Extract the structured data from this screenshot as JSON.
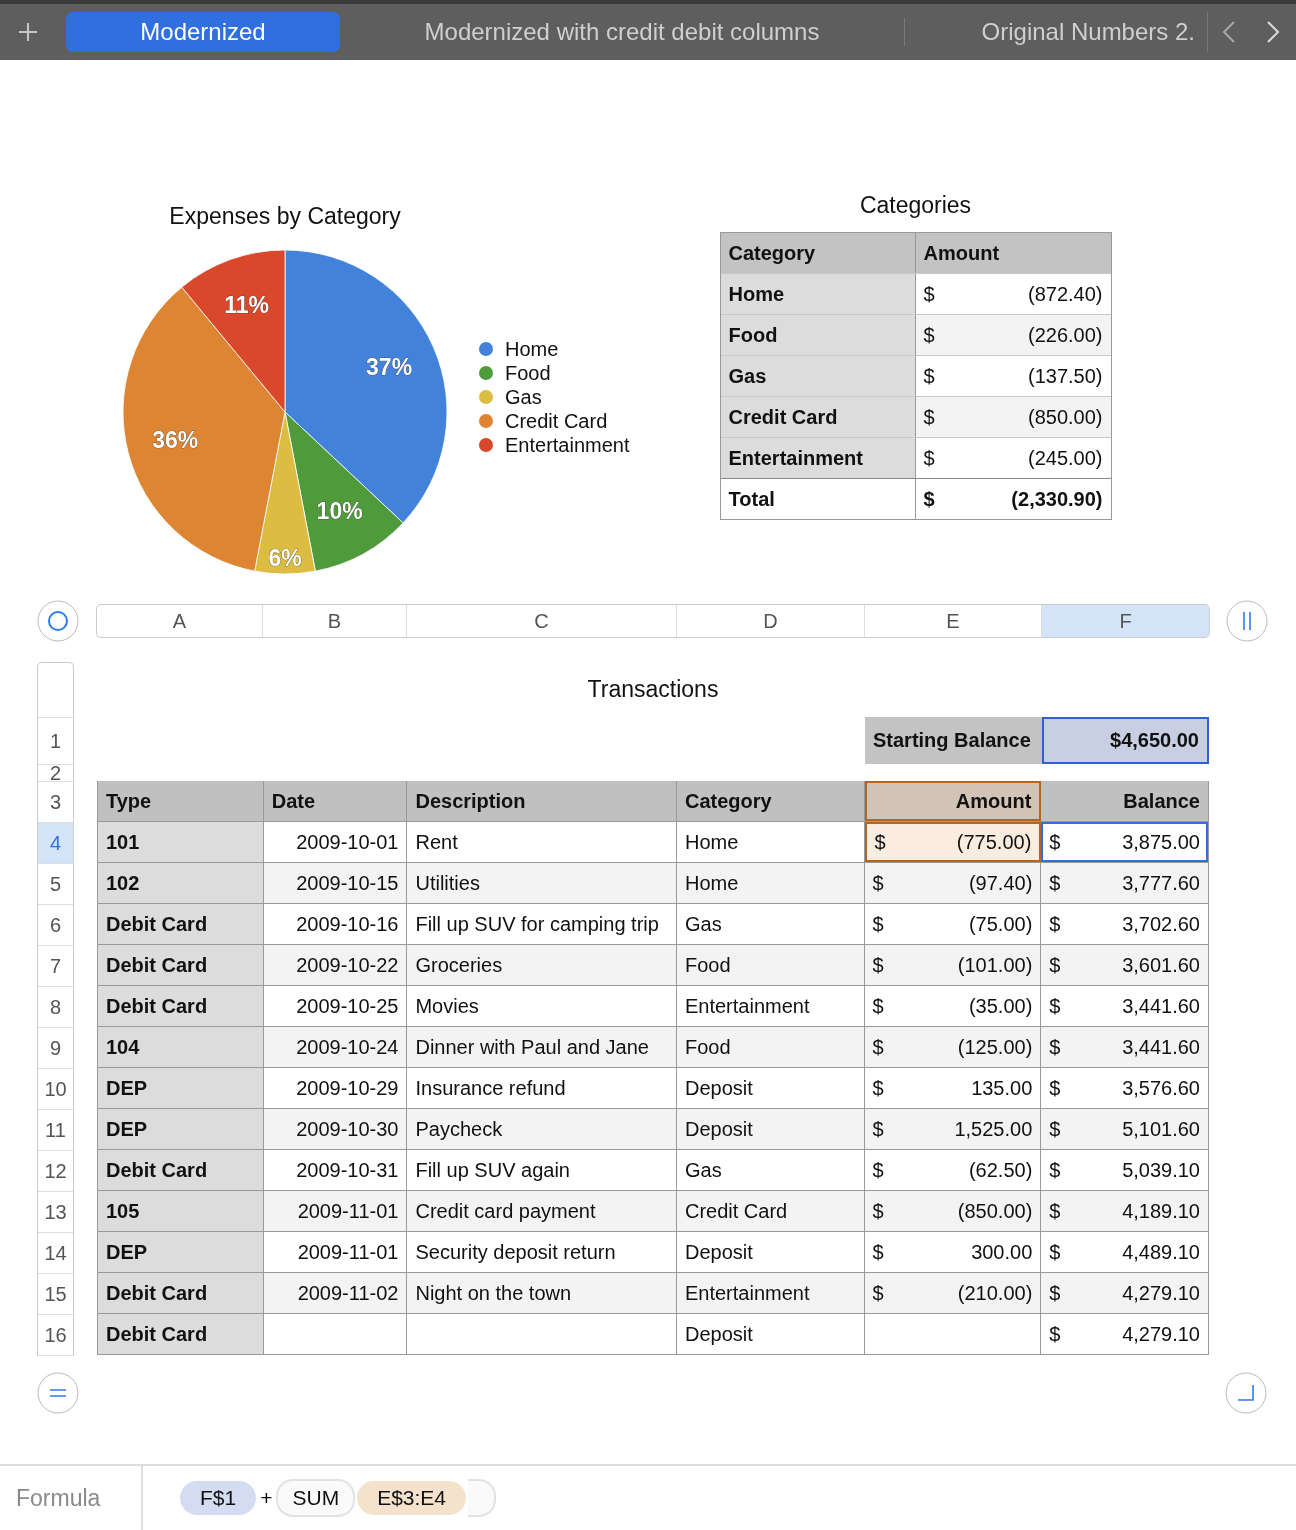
{
  "tabs": [
    {
      "label": "Modernized",
      "selected": true
    },
    {
      "label": "Modernized with credit debit columns",
      "selected": false
    },
    {
      "label": "Original Numbers 2.",
      "selected": false
    }
  ],
  "expenses_chart": {
    "chart_data": {
      "type": "pie",
      "title": "Expenses by Category",
      "categories": [
        "Home",
        "Food",
        "Gas",
        "Credit Card",
        "Entertainment"
      ],
      "values": [
        37,
        10,
        6,
        36,
        11
      ],
      "value_labels": [
        "37%",
        "10%",
        "6%",
        "36%",
        "11%"
      ]
    },
    "legend": [
      {
        "color": "#4282da"
      },
      {
        "color": "#4f9b3b"
      },
      {
        "color": "#dcbd42"
      },
      {
        "color": "#dd8533"
      },
      {
        "color": "#d9482a"
      }
    ]
  },
  "categories_table": {
    "title": "Categories",
    "columns": [
      "Category",
      "Amount"
    ],
    "rows": [
      {
        "category": "Home",
        "currency": "$",
        "amount": "(872.40)"
      },
      {
        "category": "Food",
        "currency": "$",
        "amount": "(226.00)"
      },
      {
        "category": "Gas",
        "currency": "$",
        "amount": "(137.50)"
      },
      {
        "category": "Credit Card",
        "currency": "$",
        "amount": "(850.00)"
      },
      {
        "category": "Entertainment",
        "currency": "$",
        "amount": "(245.00)"
      }
    ],
    "total": {
      "label": "Total",
      "currency": "$",
      "amount": "(2,330.90)"
    }
  },
  "column_headers": [
    {
      "label": "A",
      "selected": false
    },
    {
      "label": "B",
      "selected": false
    },
    {
      "label": "C",
      "selected": false
    },
    {
      "label": "D",
      "selected": false
    },
    {
      "label": "E",
      "selected": false
    },
    {
      "label": "F",
      "selected": true
    }
  ],
  "transactions": {
    "title": "Transactions",
    "starting_balance": {
      "label": "Starting Balance",
      "value": "$4,650.00",
      "referenced": true
    },
    "columns": [
      "Type",
      "Date",
      "Description",
      "Category",
      "Amount",
      "Balance"
    ],
    "amount_header_referenced": true,
    "rows": [
      {
        "number": "4",
        "type": "101",
        "date": "2009-10-01",
        "description": "Rent",
        "category": "Home",
        "amount_currency": "$",
        "amount": "(775.00)",
        "balance_currency": "$",
        "balance": "3,875.00",
        "selected": true,
        "amount_referenced": true
      },
      {
        "number": "5",
        "type": "102",
        "date": "2009-10-15",
        "description": "Utilities",
        "category": "Home",
        "amount_currency": "$",
        "amount": "(97.40)",
        "balance_currency": "$",
        "balance": "3,777.60",
        "selected": false,
        "amount_referenced": false
      },
      {
        "number": "6",
        "type": "Debit Card",
        "date": "2009-10-16",
        "description": "Fill up SUV for camping trip",
        "category": "Gas",
        "amount_currency": "$",
        "amount": "(75.00)",
        "balance_currency": "$",
        "balance": "3,702.60",
        "selected": false,
        "amount_referenced": false
      },
      {
        "number": "7",
        "type": "Debit Card",
        "date": "2009-10-22",
        "description": "Groceries",
        "category": "Food",
        "amount_currency": "$",
        "amount": "(101.00)",
        "balance_currency": "$",
        "balance": "3,601.60",
        "selected": false,
        "amount_referenced": false
      },
      {
        "number": "8",
        "type": "Debit Card",
        "date": "2009-10-25",
        "description": "Movies",
        "category": "Entertainment",
        "amount_currency": "$",
        "amount": "(35.00)",
        "balance_currency": "$",
        "balance": "3,441.60",
        "selected": false,
        "amount_referenced": false
      },
      {
        "number": "9",
        "type": "104",
        "date": "2009-10-24",
        "description": "Dinner with Paul and Jane",
        "category": "Food",
        "amount_currency": "$",
        "amount": "(125.00)",
        "balance_currency": "$",
        "balance": "3,441.60",
        "selected": false,
        "amount_referenced": false
      },
      {
        "number": "10",
        "type": "DEP",
        "date": "2009-10-29",
        "description": "Insurance refund",
        "category": "Deposit",
        "amount_currency": "$",
        "amount": "135.00",
        "balance_currency": "$",
        "balance": "3,576.60",
        "selected": false,
        "amount_referenced": false
      },
      {
        "number": "11",
        "type": "DEP",
        "date": "2009-10-30",
        "description": "Paycheck",
        "category": "Deposit",
        "amount_currency": "$",
        "amount": "1,525.00",
        "balance_currency": "$",
        "balance": "5,101.60",
        "selected": false,
        "amount_referenced": false
      },
      {
        "number": "12",
        "type": "Debit Card",
        "date": "2009-10-31",
        "description": "Fill up SUV again",
        "category": "Gas",
        "amount_currency": "$",
        "amount": "(62.50)",
        "balance_currency": "$",
        "balance": "5,039.10",
        "selected": false,
        "amount_referenced": false
      },
      {
        "number": "13",
        "type": "105",
        "date": "2009-11-01",
        "description": "Credit card payment",
        "category": "Credit Card",
        "amount_currency": "$",
        "amount": "(850.00)",
        "balance_currency": "$",
        "balance": "4,189.10",
        "selected": false,
        "amount_referenced": false
      },
      {
        "number": "14",
        "type": "DEP",
        "date": "2009-11-01",
        "description": "Security deposit return",
        "category": "Deposit",
        "amount_currency": "$",
        "amount": "300.00",
        "balance_currency": "$",
        "balance": "4,489.10",
        "selected": false,
        "amount_referenced": false
      },
      {
        "number": "15",
        "type": "Debit Card",
        "date": "2009-11-02",
        "description": "Night on the town",
        "category": "Entertainment",
        "amount_currency": "$",
        "amount": "(210.00)",
        "balance_currency": "$",
        "balance": "4,279.10",
        "selected": false,
        "amount_referenced": false
      },
      {
        "number": "16",
        "type": "Debit Card",
        "category": "Deposit",
        "balance_currency": "$",
        "balance": "4,279.10",
        "selected": false,
        "amount_referenced": false
      }
    ]
  },
  "row_headers": [
    {
      "label": "1",
      "selected": false
    },
    {
      "label": "2",
      "selected": false
    },
    {
      "label": "3",
      "selected": false
    }
  ],
  "formula_bar": {
    "label": "Formula",
    "tokens": [
      {
        "kind": "reference",
        "text": "F$1",
        "color": "#d3dcf0"
      },
      {
        "kind": "operator",
        "text": "+"
      },
      {
        "kind": "function",
        "text": "SUM"
      },
      {
        "kind": "reference",
        "text": "E$3:E4",
        "color": "#f5e2cd"
      }
    ]
  }
}
